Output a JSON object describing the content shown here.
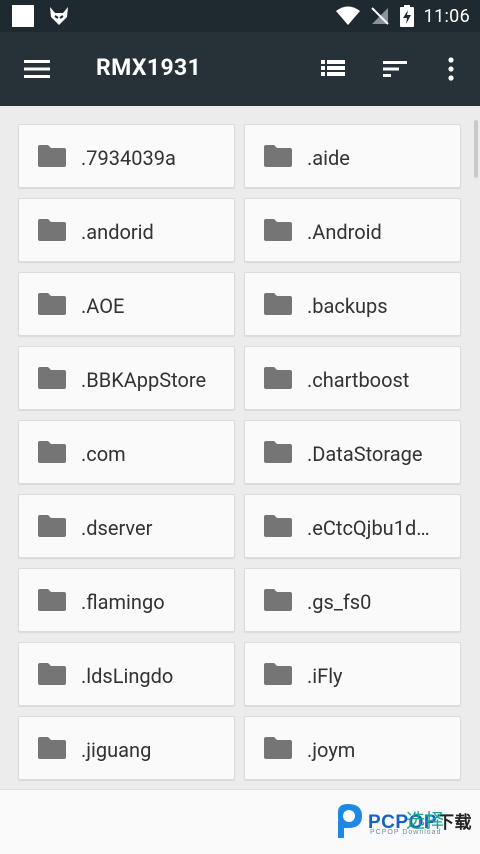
{
  "status_bar": {
    "time": "11:06",
    "icons": [
      "notification-square-icon",
      "fox-icon",
      "wifi-icon",
      "no-sim-icon",
      "battery-charging-icon"
    ]
  },
  "app_bar": {
    "title": "RMX1931",
    "icons": [
      "menu-icon",
      "list-view-icon",
      "sort-icon",
      "more-vert-icon"
    ]
  },
  "folders": [
    {
      "name": ".7934039a"
    },
    {
      "name": ".aide"
    },
    {
      "name": ".andorid"
    },
    {
      "name": ".Android"
    },
    {
      "name": ".AOE"
    },
    {
      "name": ".backups"
    },
    {
      "name": ".BBKAppStore"
    },
    {
      "name": ".chartboost"
    },
    {
      "name": ".com"
    },
    {
      "name": ".DataStorage"
    },
    {
      "name": ".dserver"
    },
    {
      "name": ".eCtcQjbu1d…"
    },
    {
      "name": ".flamingo"
    },
    {
      "name": ".gs_fs0"
    },
    {
      "name": ".ldsLingdo"
    },
    {
      "name": ".iFly"
    },
    {
      "name": ".jiguang"
    },
    {
      "name": ".joym"
    }
  ],
  "bottom_bar": {
    "select_label": "选择"
  },
  "watermark": {
    "brand": "PCPOP",
    "suffix": "下载",
    "subtitle": "PCPOP Download"
  },
  "colors": {
    "app_bar": "#263238",
    "status_bar": "#1f2a30",
    "accent": "#1aa38f",
    "folder_icon": "#757575"
  }
}
